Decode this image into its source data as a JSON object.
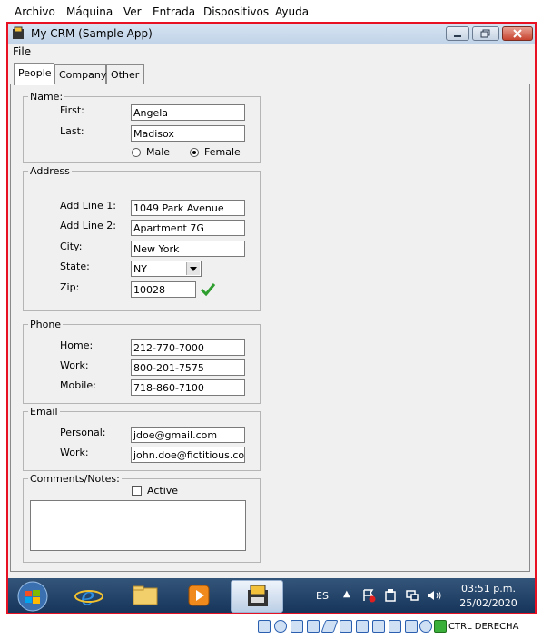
{
  "host_menu": [
    "Archivo",
    "Máquina",
    "Ver",
    "Entrada",
    "Dispositivos",
    "Ayuda"
  ],
  "window": {
    "title": "My CRM (Sample App)",
    "menu_file": "File"
  },
  "tabs": [
    "People",
    "Company",
    "Other"
  ],
  "name_group": {
    "title": "Name:",
    "first_label": "First:",
    "first_value": "Angela",
    "last_label": "Last:",
    "last_value": "Madisox",
    "male_label": "Male",
    "female_label": "Female",
    "selected": "Female"
  },
  "address_group": {
    "title": "Address",
    "line1_label": "Add Line 1:",
    "line1_value": "1049 Park Avenue",
    "line2_label": "Add Line 2:",
    "line2_value": "Apartment 7G",
    "city_label": "City:",
    "city_value": "New York",
    "state_label": "State:",
    "state_value": "NY",
    "zip_label": "Zip:",
    "zip_value": "10028"
  },
  "phone_group": {
    "title": "Phone",
    "home_label": "Home:",
    "home_value": "212-770-7000",
    "work_label": "Work:",
    "work_value": "800-201-7575",
    "mobile_label": "Mobile:",
    "mobile_value": "718-860-7100"
  },
  "email_group": {
    "title": "Email",
    "personal_label": "Personal:",
    "personal_value": "jdoe@gmail.com",
    "work_label": "Work:",
    "work_value": "john.doe@fictitious.com"
  },
  "comments_group": {
    "title": "Comments/Notes:",
    "active_label": "Active",
    "active_checked": false
  },
  "taskbar": {
    "lang": "ES",
    "time": "03:51 p.m.",
    "date": "25/02/2020"
  },
  "statusbar": {
    "host_key": "CTRL DERECHA"
  },
  "colors": {
    "frame_red": "#e81123",
    "taskbar": "#1f3f66",
    "check_green": "#2e9e2e"
  }
}
